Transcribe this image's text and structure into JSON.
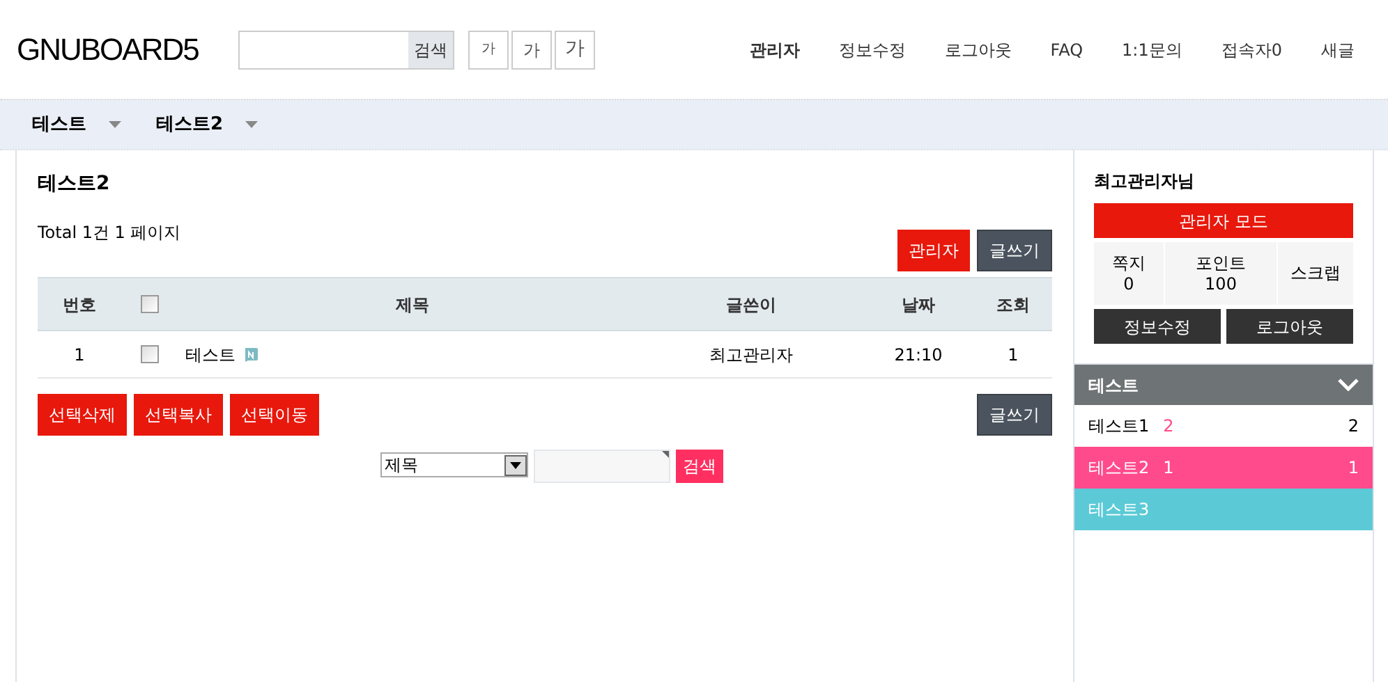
{
  "logo": "GNUBOARD5",
  "search": {
    "button": "검색"
  },
  "font_sizes": [
    "가",
    "가",
    "가"
  ],
  "top_links": [
    {
      "label": "관리자",
      "bold": true
    },
    {
      "label": "정보수정",
      "bold": false
    },
    {
      "label": "로그아웃",
      "bold": false
    },
    {
      "label": "FAQ",
      "bold": false
    },
    {
      "label": "1:1문의",
      "bold": false
    },
    {
      "label": "접속자0",
      "bold": false
    },
    {
      "label": "새글",
      "bold": false
    }
  ],
  "nav": [
    "테스트",
    "테스트2"
  ],
  "board": {
    "title": "테스트2",
    "total": "Total 1건 1 페이지",
    "admin_button": "관리자",
    "write_button": "글쓰기",
    "columns": [
      "번호",
      "",
      "제목",
      "글쓴이",
      "날짜",
      "조회"
    ],
    "rows": [
      {
        "num": "1",
        "checked": false,
        "subject": "테스트",
        "is_new": true,
        "author": "최고관리자",
        "date": "21:10",
        "views": "1"
      }
    ],
    "header_checked": false,
    "actions": [
      "선택삭제",
      "선택복사",
      "선택이동"
    ],
    "write_button_bottom": "글쓰기",
    "search_select": "제목",
    "search_button": "검색"
  },
  "sidebar": {
    "user": "최고관리자님",
    "admin_mode": "관리자 모드",
    "stats": [
      {
        "label": "쪽지",
        "value": "0"
      },
      {
        "label": "포인트",
        "value": "100"
      },
      {
        "label": "스크랩"
      }
    ],
    "buttons": [
      "정보수정",
      "로그아웃"
    ],
    "group": {
      "title": "테스트",
      "expanded": true
    },
    "menu": [
      {
        "label": "테스트1",
        "new_count": "2",
        "count": "2",
        "color": "#ffffff"
      },
      {
        "label": "테스트2",
        "new_count": "1",
        "count": "1",
        "color": "#ff4b8c"
      },
      {
        "label": "테스트3",
        "color": "#5bcad6"
      }
    ]
  }
}
